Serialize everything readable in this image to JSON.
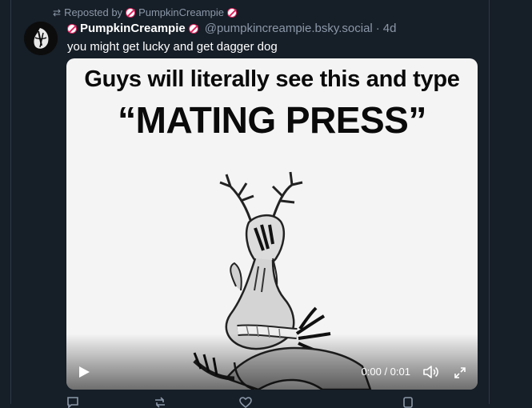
{
  "repost": {
    "label": "Reposted by",
    "user": "PumpkinCreampie",
    "icon": "repost-icon"
  },
  "post": {
    "display_name": "PumpkinCreampie",
    "handle": "@pumpkincreampie.bsky.social",
    "separator": "·",
    "time": "4d",
    "text": "you might get lucky and get dagger dog",
    "badge_icon": "adult-content-badge-icon",
    "avatar_icon": "avatar-image"
  },
  "media": {
    "caption_line1": "Guys will literally see this and type",
    "caption_line2": "“MATING PRESS”",
    "timecode": "0:00 / 0:01",
    "play_icon": "play-icon",
    "volume_icon": "volume-icon",
    "fullscreen_icon": "fullscreen-icon"
  },
  "actions": {
    "reply_icon": "reply-icon",
    "repost_icon": "repost-icon",
    "like_icon": "like-icon",
    "more_icon": "more-icon"
  },
  "colors": {
    "background": "#161e27",
    "muted": "#8b98a9",
    "badge": "#e0245e"
  }
}
